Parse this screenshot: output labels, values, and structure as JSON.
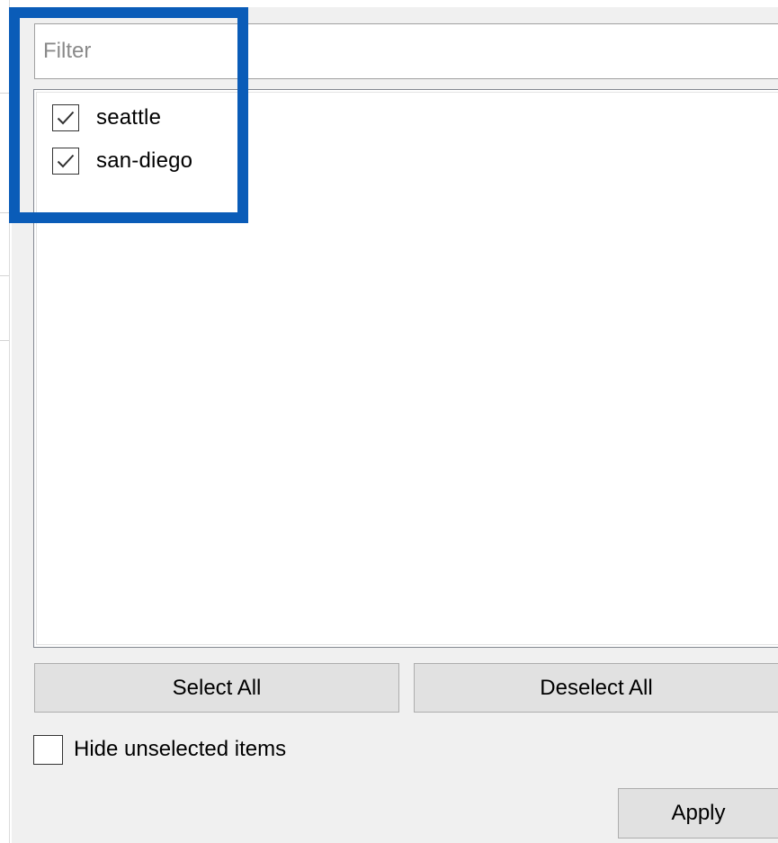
{
  "filter": {
    "placeholder": "Filter",
    "value": ""
  },
  "list": {
    "items": [
      {
        "label": "seattle",
        "checked": true
      },
      {
        "label": "san-diego",
        "checked": true
      }
    ]
  },
  "buttons": {
    "select_all": "Select All",
    "deselect_all": "Deselect All",
    "apply": "Apply"
  },
  "options": {
    "hide_unselected_label": "Hide unselected items",
    "hide_unselected_checked": false
  },
  "colors": {
    "highlight": "#0a5cb8",
    "panel_background": "#f0f0f0",
    "button_background": "#e1e1e1"
  }
}
